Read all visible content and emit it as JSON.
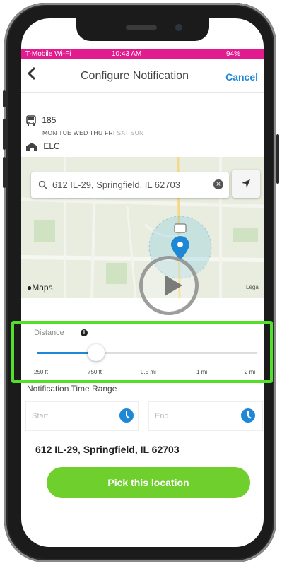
{
  "status_bar": {
    "carrier": "T-Mobile Wi-Fi",
    "time": "10:43 AM",
    "battery": "94%",
    "color": "#e21b8e"
  },
  "nav": {
    "back_icon": "chevron-left-icon",
    "title": "Configure Notification",
    "cancel_label": "Cancel",
    "accent": "#1e88d6"
  },
  "route": {
    "bus_icon": "bus-icon",
    "number": "185",
    "days_active": "MON TUE WED THU FRI",
    "days_inactive": "SAT SUN",
    "stop_icon": "bus-stop-icon",
    "stop": "ELC"
  },
  "map": {
    "search_value": "612 IL-29, Springfield, IL 62703",
    "logo": "Maps",
    "legal": "Legal"
  },
  "distance": {
    "label": "Distance",
    "info_icon": "i",
    "ticks": [
      "250 ft",
      "750 ft",
      "0.5 mi",
      "1 mi",
      "2 mi"
    ],
    "selected": "750 ft",
    "slider_fraction": 0.27
  },
  "time_range": {
    "label": "Notification Time Range",
    "start_placeholder": "Start",
    "end_placeholder": "End"
  },
  "location": {
    "address": "612 IL-29, Springfield, IL 62703",
    "pick_label": "Pick this location",
    "button_color": "#6fcf2c"
  },
  "overlay": {
    "highlight_color": "#53e02b"
  }
}
